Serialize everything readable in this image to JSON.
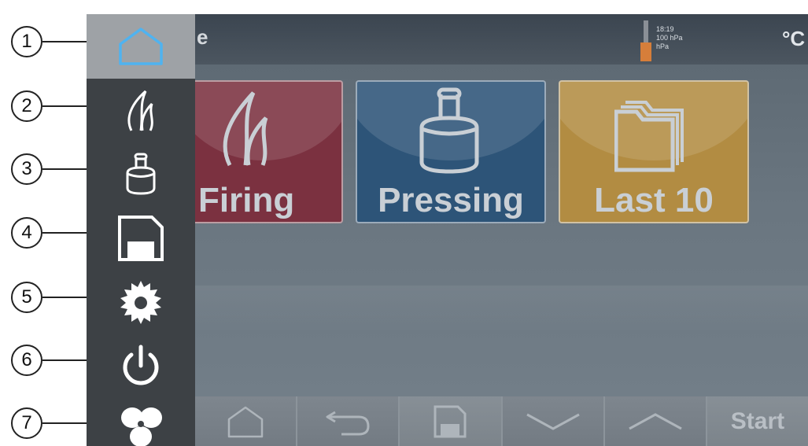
{
  "callouts": [
    "1",
    "2",
    "3",
    "4",
    "5",
    "6",
    "7"
  ],
  "header": {
    "title_fragment": "e",
    "time": "18:19",
    "pressure_primary": "100 hPa",
    "pressure_secondary": "hPa",
    "temperature_unit": "°C"
  },
  "menu": {
    "items": [
      {
        "icon": "home-icon",
        "active": true
      },
      {
        "icon": "flame-icon",
        "active": false
      },
      {
        "icon": "press-icon",
        "active": false
      },
      {
        "icon": "save-icon",
        "active": false
      },
      {
        "icon": "gear-icon",
        "active": false
      },
      {
        "icon": "power-icon",
        "active": false
      },
      {
        "icon": "fan-icon",
        "active": false
      }
    ]
  },
  "tiles": [
    {
      "label": "Firing",
      "icon": "flame-icon",
      "color": "#7b3140"
    },
    {
      "label": "Pressing",
      "icon": "press-icon",
      "color": "#2d5478"
    },
    {
      "label": "Last 10",
      "icon": "folder-stack-icon",
      "color": "#b28c42"
    }
  ],
  "bottombar": {
    "start_label": "Start",
    "buttons": [
      "home-icon",
      "back-icon",
      "save-icon",
      "chevron-down-icon",
      "chevron-up-icon"
    ]
  },
  "colors": {
    "menu_bg": "#3d4145",
    "menu_active": "#9ea2a6",
    "thermo_fill": "#d67e3a",
    "icon_active": "#4fb3f0"
  }
}
